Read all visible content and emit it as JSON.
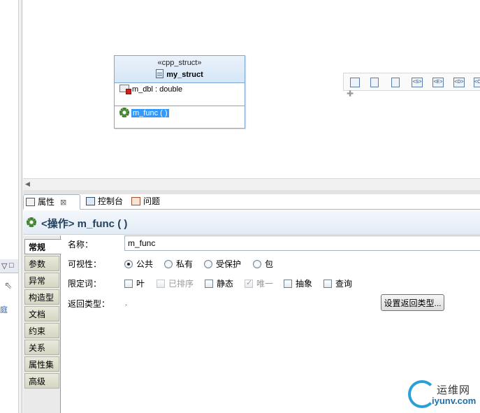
{
  "left_panel": {
    "link_text": "庭"
  },
  "diagram": {
    "class_box": {
      "stereotype": "«cpp_struct»",
      "name": "my_struct",
      "attribute": "m_dbl : double",
      "operation": "m_func ( )"
    },
    "palette": {
      "buttons": [
        {
          "icon": "folder-icon"
        },
        {
          "icon": "class-icon"
        },
        {
          "icon": "struct-icon"
        },
        {
          "label": "<S>"
        },
        {
          "label": "<E>"
        },
        {
          "label": "<D>"
        },
        {
          "label": "<C>"
        }
      ]
    }
  },
  "tabs": [
    {
      "label": "属性",
      "active": true,
      "close": "⊠"
    },
    {
      "label": "控制台",
      "active": false
    },
    {
      "label": "问题",
      "active": false
    }
  ],
  "properties": {
    "title": "<操作> m_func ( )",
    "side_tabs": [
      "常规",
      "参数",
      "异常",
      "构造型",
      "文档",
      "约束",
      "关系",
      "属性集",
      "高级"
    ],
    "form": {
      "name_label": "名称：",
      "name_value": "m_func",
      "visibility_label": "可视性：",
      "visibility_options": [
        "公共",
        "私有",
        "受保护",
        "包"
      ],
      "visibility_selected": "公共",
      "qualifier_label": "限定词：",
      "qualifiers": [
        {
          "label": "叶",
          "checked": false,
          "disabled": false
        },
        {
          "label": "已排序",
          "checked": false,
          "disabled": true
        },
        {
          "label": "静态",
          "checked": false,
          "disabled": false
        },
        {
          "label": "唯一",
          "checked": true,
          "disabled": true
        },
        {
          "label": "抽象",
          "checked": false,
          "disabled": false
        },
        {
          "label": "查询",
          "checked": false,
          "disabled": false
        }
      ],
      "return_type_label": "返回类型：",
      "return_type_value": ".",
      "set_return_button": "设置返回类型..."
    }
  },
  "watermark": {
    "name": "运维网",
    "url": "iyunv.com"
  },
  "colors": {
    "selection": "#3399ff",
    "class_border": "#7ea8cf",
    "header_title": "#24425f"
  }
}
